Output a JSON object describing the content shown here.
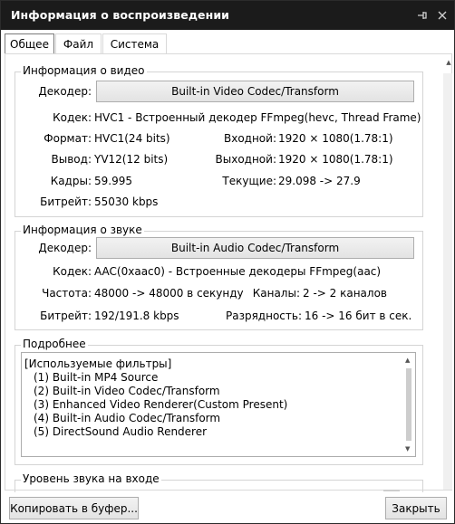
{
  "window": {
    "title": "Информация о воспроизведении"
  },
  "tabs": [
    {
      "label": "Общее"
    },
    {
      "label": "Файл"
    },
    {
      "label": "Система"
    }
  ],
  "video": {
    "group_title": "Информация о видео",
    "decoder_label": "Декодер:",
    "decoder_value": "Built-in Video Codec/Transform",
    "codec_label": "Кодек:",
    "codec_value": "HVC1 - Встроенный декодер FFmpeg(hevc, Thread Frame)",
    "format_label": "Формат:",
    "format_value": "HVC1(24 bits)",
    "input_label": "Входной:",
    "input_value": "1920 × 1080(1.78:1)",
    "output_label": "Вывод:",
    "output_value": "YV12(12 bits)",
    "outsize_label": "Выходной:",
    "outsize_value": "1920 × 1080(1.78:1)",
    "frames_label": "Кадры:",
    "frames_value": "59.995",
    "current_label": "Текущие:",
    "current_value": "29.098 -> 27.9",
    "bitrate_label": "Битрейт:",
    "bitrate_value": "55030 kbps"
  },
  "audio": {
    "group_title": "Информация о звуке",
    "decoder_label": "Декодер:",
    "decoder_value": "Built-in Audio Codec/Transform",
    "codec_label": "Кодек:",
    "codec_value": "AAC(0xaac0) - Встроенные декодеры FFmpeg(aac)",
    "freq_label": "Частота:",
    "freq_value": "48000 -> 48000 в секунду",
    "channels_label": "Каналы:",
    "channels_value": "2 -> 2 каналов",
    "bitrate_label": "Битрейт:",
    "bitrate_value": "192/191.8 kbps",
    "depth_label": "Разрядность:",
    "depth_value": "16 -> 16 бит в сек."
  },
  "details": {
    "group_title": "Подробнее",
    "lines": [
      "[Используемые фильтры]",
      "(1) Built-in MP4 Source",
      "(2) Built-in Video Codec/Transform",
      "(3) Enhanced Video Renderer(Custom Present)",
      "(4) Built-in Audio Codec/Transform",
      "(5) DirectSound Audio Renderer"
    ]
  },
  "input_level": {
    "group_title": "Уровень звука на входе"
  },
  "footer": {
    "copy_label": "Копировать в буфер...",
    "close_label": "Закрыть"
  }
}
